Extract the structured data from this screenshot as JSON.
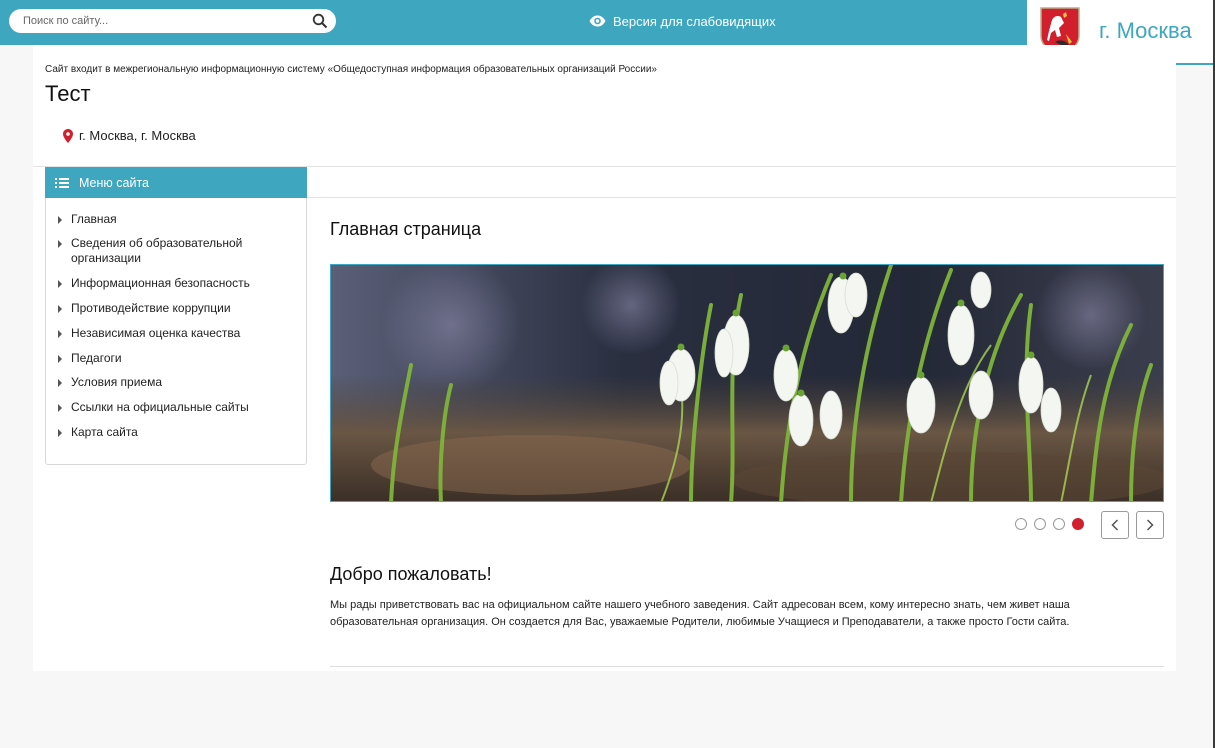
{
  "header": {
    "search_placeholder": "Поиск по сайту...",
    "search_icon": "search-icon",
    "vision_label": "Версия для слабовидящих",
    "vision_icon": "eye-icon",
    "city_name": "г. Москва",
    "coat_of_arms": "moscow-coat-of-arms"
  },
  "site": {
    "notice": "Сайт входит в межрегиональную информационную систему «Общедоступная информация образовательных организаций России»",
    "title": "Тест",
    "address": "г. Москва, г. Москва",
    "address_icon": "location-pin-icon"
  },
  "sidebar": {
    "menu_title": "Меню сайта",
    "menu_icon": "list-icon",
    "items": [
      {
        "label": "Главная"
      },
      {
        "label": "Сведения об образовательной организации"
      },
      {
        "label": "Информационная безопасность"
      },
      {
        "label": "Противодействие коррупции"
      },
      {
        "label": "Независимая оценка качества"
      },
      {
        "label": "Педагоги"
      },
      {
        "label": "Условия приема"
      },
      {
        "label": "Ссылки на официальные сайты"
      },
      {
        "label": "Карта сайта"
      }
    ]
  },
  "main": {
    "page_heading": "Главная страница",
    "slider": {
      "slide_count": 4,
      "active_slide": 4,
      "prev_icon": "chevron-left-icon",
      "next_icon": "chevron-right-icon"
    },
    "welcome_heading": "Добро пожаловать!",
    "welcome_text": "Мы рады приветствовать вас на официальном сайте нашего учебного заведения. Сайт адресован всем, кому интересно знать, чем живет наша образовательная организация. Он создается для Вас, уважаемые Родители, любимые Учащиеся и Преподаватели, а также просто Гости сайта."
  },
  "colors": {
    "accent": "#3ea6bf",
    "active_dot": "#d11f2e",
    "pin": "#d11f2e"
  }
}
